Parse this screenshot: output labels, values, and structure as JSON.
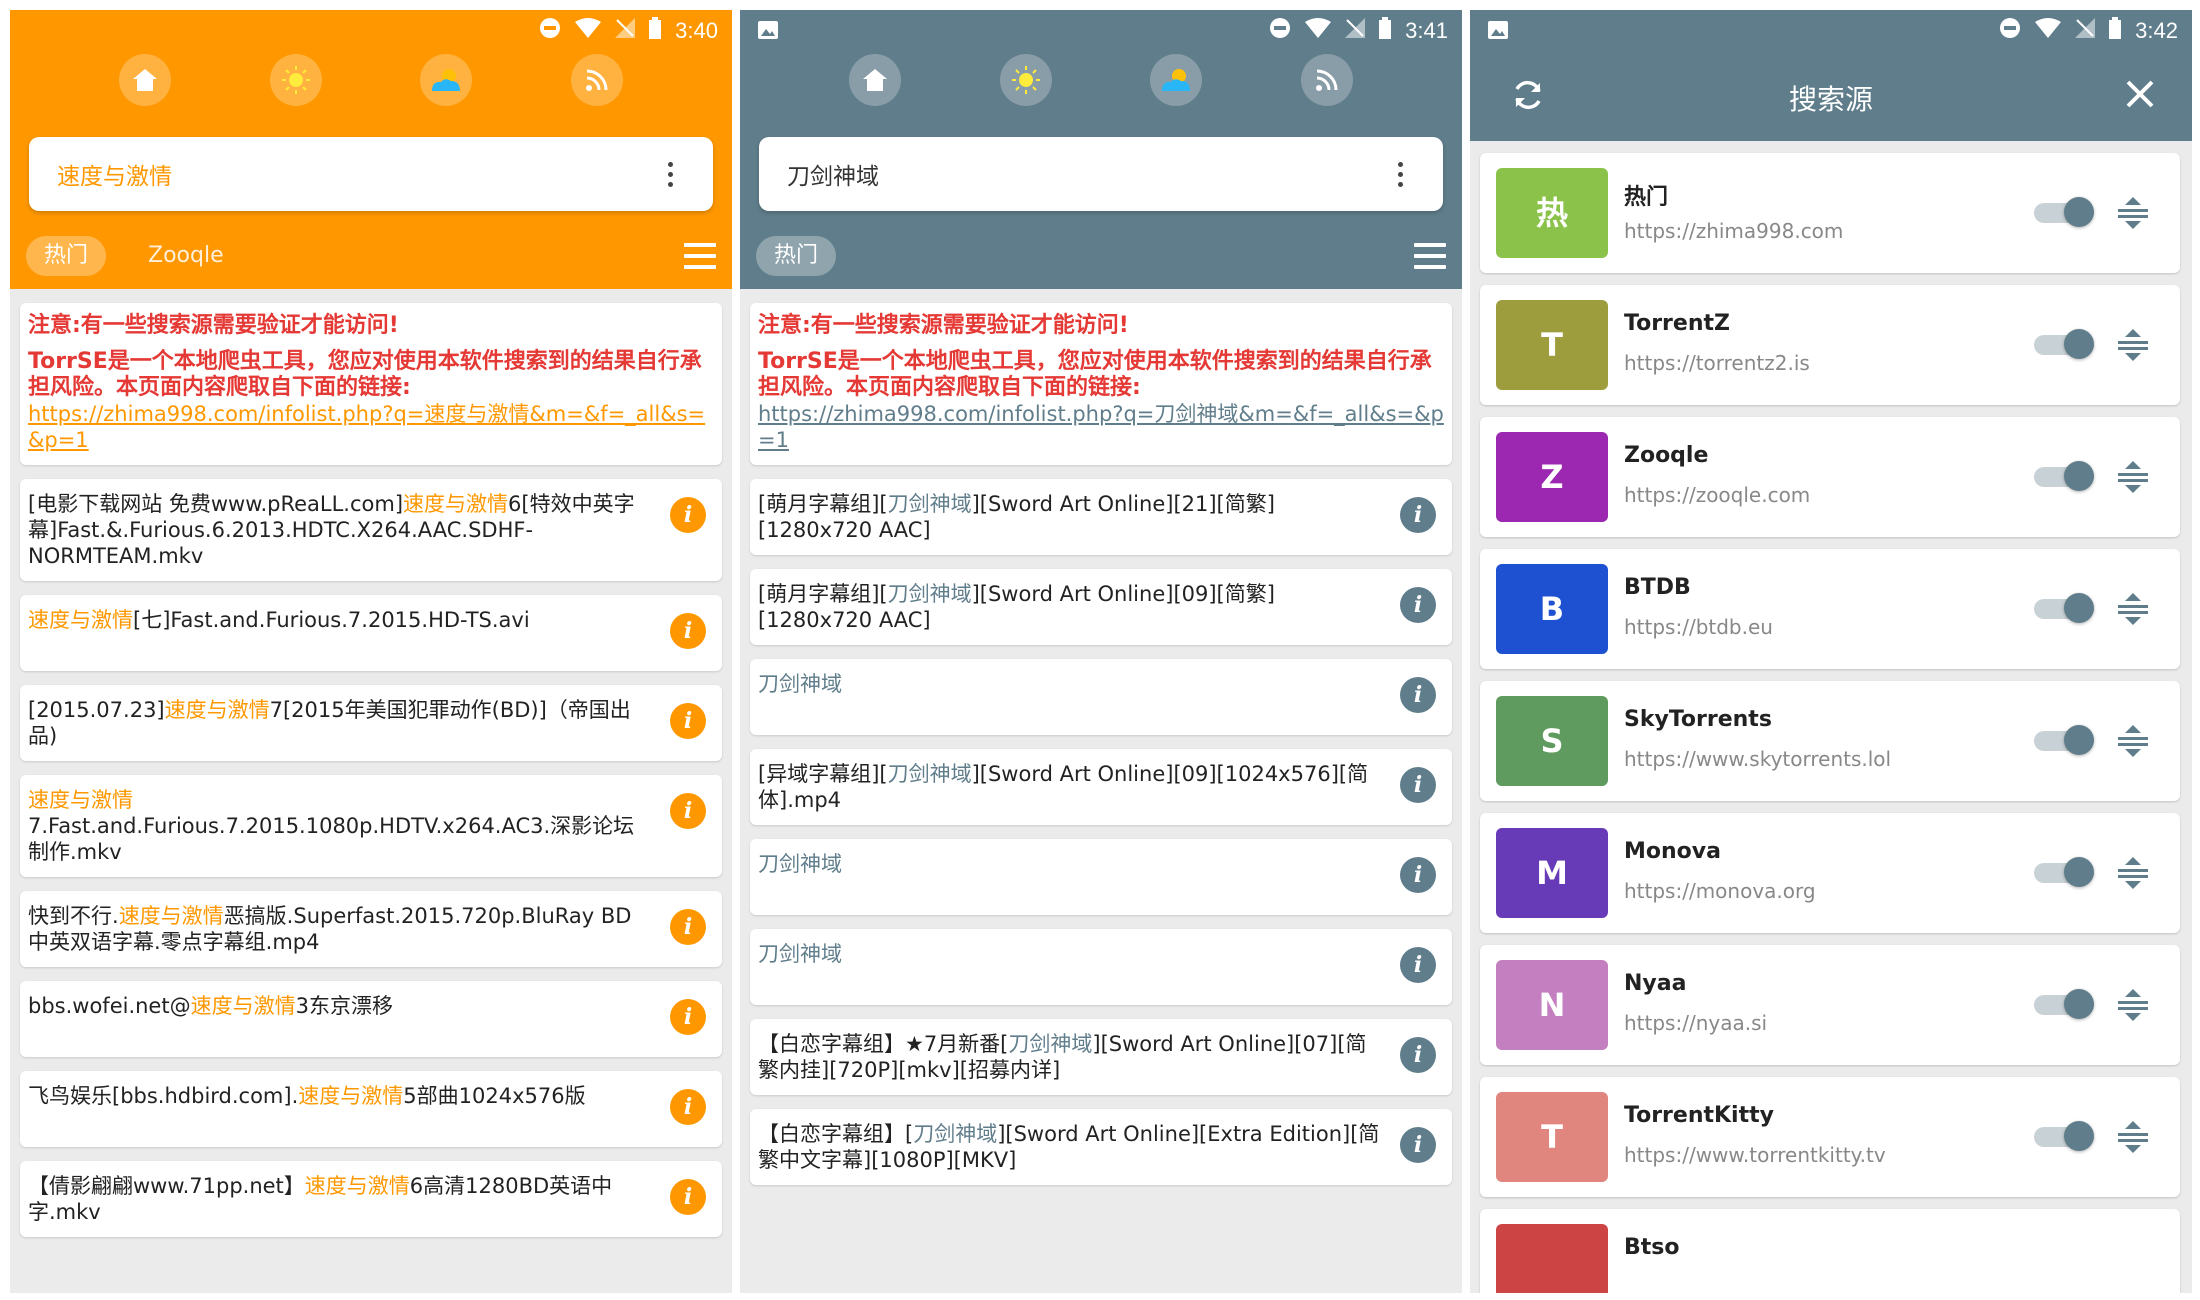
{
  "colors": {
    "orange": "#ff9800",
    "bluegrey": "#607d8b",
    "warning_red": "#e53935"
  },
  "phone1": {
    "status_time": "3:40",
    "nav_icons": [
      "home-icon",
      "sun-icon",
      "weather-icon",
      "rss-icon"
    ],
    "query": "速度与激情",
    "tabs": [
      "热门",
      "Zooqle"
    ],
    "notice": {
      "t1": "注意:有一些搜索源需要验证才能访问!",
      "t2": "TorrSE是一个本地爬虫工具，您应对使用本软件搜索到的结果自行承担风险。本页面内容爬取自下面的链接:",
      "url": "https://zhima998.com/infolist.php?q=速度与激情&m=&f=_all&s=&p=1"
    },
    "items": [
      {
        "pre": "[电影下载网站 免费www.pReaLL.com]",
        "hl": "速度与激情",
        "post": "6[特效中英字幕]Fast.&.Furious.6.2013.HDTC.X264.AAC.SDHF-NORMTEAM.mkv"
      },
      {
        "pre": "",
        "hl": "速度与激情",
        "post": "[七]Fast.and.Furious.7.2015.HD-TS.avi"
      },
      {
        "pre": "[2015.07.23]",
        "hl": "速度与激情",
        "post": "7[2015年美国犯罪动作(BD)]（帝国出品)"
      },
      {
        "pre": "",
        "hl": "速度与激情",
        "post": "7.Fast.and.Furious.7.2015.1080p.HDTV.x264.AC3.深影论坛制作.mkv"
      },
      {
        "pre": "快到不行.",
        "hl": "速度与激情",
        "post": "恶搞版.Superfast.2015.720p.BluRay BD中英双语字幕.零点字幕组.mp4"
      },
      {
        "pre": "bbs.wofei.net@",
        "hl": "速度与激情",
        "post": "3东京漂移"
      },
      {
        "pre": "飞鸟娱乐[bbs.hdbird.com].",
        "hl": "速度与激情",
        "post": "5部曲1024x576版"
      },
      {
        "pre": "【倩影翩翩www.71pp.net】",
        "hl": "速度与激情",
        "post": "6高清1280BD英语中字.mkv"
      }
    ]
  },
  "phone2": {
    "status_time": "3:41",
    "nav_icons": [
      "home-icon",
      "sun-icon",
      "weather-icon",
      "rss-icon"
    ],
    "query": "刀剑神域",
    "tabs": [
      "热门"
    ],
    "notice": {
      "t1": "注意:有一些搜索源需要验证才能访问!",
      "t2": "TorrSE是一个本地爬虫工具，您应对使用本软件搜索到的结果自行承担风险。本页面内容爬取自下面的链接:",
      "url": "https://zhima998.com/infolist.php?q=刀剑神域&m=&f=_all&s=&p=1"
    },
    "items": [
      {
        "pre": "[萌月字幕组][",
        "hl": "刀剑神域",
        "post": "][Sword Art Online][21][简繁][1280x720 AAC]"
      },
      {
        "pre": "[萌月字幕组][",
        "hl": "刀剑神域",
        "post": "][Sword Art Online][09][简繁][1280x720 AAC]"
      },
      {
        "pre": "",
        "hl": "刀剑神域",
        "post": ""
      },
      {
        "pre": "[异域字幕组][",
        "hl": "刀剑神域",
        "post": "][Sword Art Online][09][1024x576][简体].mp4"
      },
      {
        "pre": "",
        "hl": "刀剑神域",
        "post": ""
      },
      {
        "pre": "",
        "hl": "刀剑神域",
        "post": ""
      },
      {
        "pre": "【白恋字幕组】★7月新番[",
        "hl": "刀剑神域",
        "post": "][Sword Art Online][07][简繁内挂][720P][mkv][招募内详]"
      },
      {
        "pre": "【白恋字幕组】[",
        "hl": "刀剑神域",
        "post": "][Sword Art Online][Extra Edition][简繁中文字幕][1080P][MKV]"
      }
    ]
  },
  "phone3": {
    "status_time": "3:42",
    "title": "搜索源",
    "sources": [
      {
        "letter": "热",
        "name": "热门",
        "url": "https://zhima998.com",
        "color": "#8bc34a"
      },
      {
        "letter": "T",
        "name": "TorrentZ",
        "url": "https://torrentz2.is",
        "color": "#9e9d3e"
      },
      {
        "letter": "Z",
        "name": "Zooqle",
        "url": "https://zooqle.com",
        "color": "#9c27b0"
      },
      {
        "letter": "B",
        "name": "BTDB",
        "url": "https://btdb.eu",
        "color": "#1e50d2"
      },
      {
        "letter": "S",
        "name": "SkyTorrents",
        "url": "https://www.skytorrents.lol",
        "color": "#5f9a5e"
      },
      {
        "letter": "M",
        "name": "Monova",
        "url": "https://monova.org",
        "color": "#673ab7"
      },
      {
        "letter": "N",
        "name": "Nyaa",
        "url": "https://nyaa.si",
        "color": "#c47fc0"
      },
      {
        "letter": "T",
        "name": "TorrentKitty",
        "url": "https://www.torrentkitty.tv",
        "color": "#e0867f"
      },
      {
        "letter": "",
        "name": "Btso",
        "url": "",
        "color": "#cc4444"
      }
    ]
  }
}
